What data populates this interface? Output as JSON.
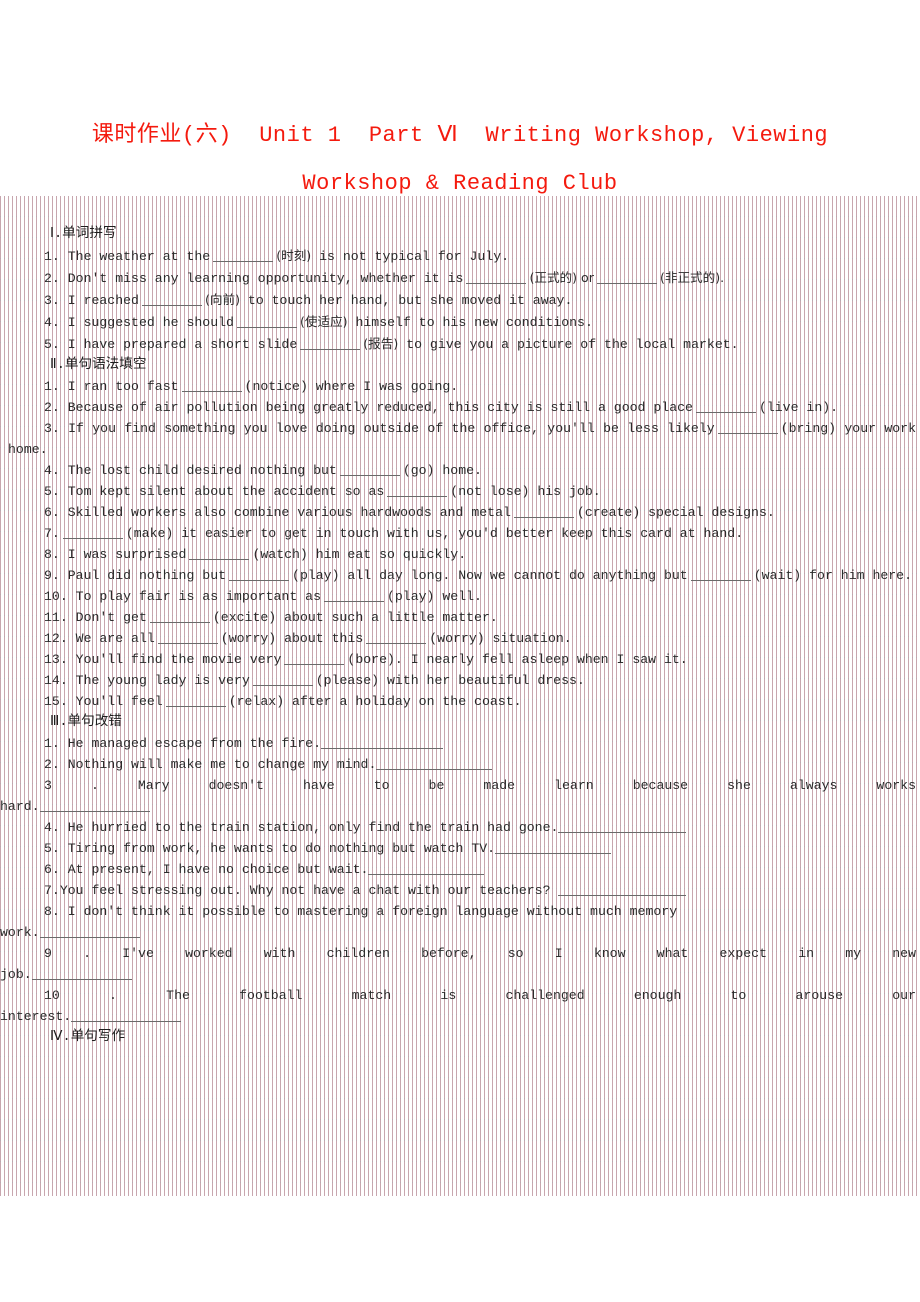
{
  "document": {
    "title_line1": "课时作业(六)  Unit 1  Part Ⅵ  Writing Workshop, Viewing",
    "title_line2": "Workshop & Reading Club",
    "title_color": "#f41a0e"
  },
  "sections": [
    {
      "heading": "Ⅰ.单词拼写",
      "items": [
        "1. The weather at the ______ (时刻) is not typical for July.",
        "2. Don't miss any learning opportunity, whether it is ______ (正式的) or ______ (非正式的).",
        "3. I reached ______ (向前) to touch her hand, but she moved it away.",
        "4. I suggested he should ______ (使适应) himself to his new conditions.",
        "5. I have prepared a short slide ______ (报告) to give you a picture of the local market."
      ]
    },
    {
      "heading": "Ⅱ.单句语法填空",
      "items": [
        "1. I ran too fast ______ (notice) where I was going.",
        "2. Because of air pollution being greatly reduced, this city is still a good place ______ (live in).",
        "3. If you find something you love doing outside of the office, you'll be less likely ______ (bring) your work home.",
        "4. The lost child desired nothing but ______ (go) home.",
        "5. Tom kept silent about the accident so as ______ (not lose) his job.",
        "6. Skilled workers also combine various hardwoods and metal ______ (create) special designs.",
        "7. ______ (make) it easier to get in touch with us, you'd better keep this card at hand.",
        "8. I was surprised ______ (watch) him eat so quickly.",
        "9. Paul did nothing but ______ (play) all day long. Now we cannot do anything but ______ (wait) for him here.",
        "10. To play fair is as important as ______ (play) well.",
        "11. Don't get ______ (excite) about such a little matter.",
        "12. We are all ______ (worry) about this ______ (worry) situation.",
        "13. You'll find the movie very ______ (bore). I nearly fell asleep when I saw it.",
        "14. The young lady is very ______ (please) with her beautiful dress.",
        "15. You'll feel ______ (relax) after a holiday on the coast."
      ]
    },
    {
      "heading": "Ⅲ.单句改错",
      "items": [
        "1. He managed escape from the fire.",
        "2. Nothing will make me to change my mind.",
        "3 . Mary doesn't have to be made learn because she always works hard.",
        "4. He hurried to the train station, only find the train had gone.",
        "5. Tiring from work, he wants to do nothing but watch TV.",
        "6. At present, I have no choice but wait.",
        "7.You feel stressing out. Why not have a chat with our teachers?",
        "8. I don't think it possible to mastering a foreign language without much memory work.",
        "9 . I've worked with children before, so I know what expect in my new job.",
        "10 . The football match is challenged enough to arouse our interest."
      ]
    },
    {
      "heading": "Ⅳ.单句写作",
      "items": []
    }
  ],
  "fragments": {
    "s1_q1_a": "1. The weather at the",
    "s1_q1_cn": "(时刻)",
    "s1_q1_b": "is not typical for July.",
    "s1_q2_a": "2. Don't miss any learning opportunity, whether it is",
    "s1_q2_cn1": "(正式的) or",
    "s1_q2_cn2": "(非正式的).",
    "s1_q3_a": "3. I reached",
    "s1_q3_cn": "(向前)",
    "s1_q3_b": "to touch her hand, but she moved it away.",
    "s1_q4_a": "4. I suggested he should",
    "s1_q4_cn": "(使适应)",
    "s1_q4_b": "himself to his new conditions.",
    "s1_q5_a": "5. I have prepared a short slide",
    "s1_q5_cn": "(报告)",
    "s1_q5_b": "to give you a picture of the local market.",
    "s2_q1_a": "1. I ran too fast",
    "s2_q1_b": "(notice) where I was going.",
    "s2_q2_a": "2. Because of air pollution being greatly reduced, this city is still a good place",
    "s2_q2_b": "(live in).",
    "s2_q3_a": "3. If you find something you love doing outside of the office, you'll be less likely",
    "s2_q3_b": "(bring) your work home.",
    "s2_q4_a": "4. The lost child desired nothing but",
    "s2_q4_b": "(go) home.",
    "s2_q5_a": "5. Tom kept silent about the accident so as",
    "s2_q5_b": "(not lose) his job.",
    "s2_q6_a": "6. Skilled workers also combine various hardwoods and metal",
    "s2_q6_b": "(create) special designs.",
    "s2_q7_a": "7.",
    "s2_q7_b": "(make) it easier to get in touch with us, you'd better keep this card at hand.",
    "s2_q8_a": "8. I was surprised",
    "s2_q8_b": "(watch) him eat so quickly.",
    "s2_q9_a": "9. Paul did nothing but",
    "s2_q9_b": "(play) all day long. Now we cannot do anything but",
    "s2_q9_c": "(wait) for him here.",
    "s2_q10_a": "10. To play fair is as important as",
    "s2_q10_b": "(play) well.",
    "s2_q11_a": "11. Don't get",
    "s2_q11_b": "(excite) about such a little matter.",
    "s2_q12_a": "12. We are all",
    "s2_q12_b": "(worry) about this",
    "s2_q12_c": "(worry) situation.",
    "s2_q13_a": "13. You'll find the movie very",
    "s2_q13_b": "(bore). I nearly fell asleep when I saw it.",
    "s2_q14_a": "14. The young lady is very",
    "s2_q14_b": "(please) with her beautiful dress.",
    "s2_q15_a": "15. You'll feel",
    "s2_q15_b": "(relax) after a holiday on the coast.",
    "s3_q1": "1. He managed escape from the fire.",
    "s3_q2": "2. Nothing will make me to change my mind.",
    "s3_q3": "3 . Mary doesn't have to be made learn because she always works",
    "s3_q3_tail": "hard.",
    "s3_q4": "4. He hurried to the train station, only find the train had gone.",
    "s3_q5": "5. Tiring from work, he wants to do nothing but watch TV.",
    "s3_q6": "6. At present, I have no choice but wait.",
    "s3_q7": "7.You feel stressing out. Why not have a chat with our teachers?",
    "s3_q8": "8. I don't think it possible to mastering a foreign language without much memory",
    "s3_q8_tail": "work.",
    "s3_q9": "9 . I've worked with children before, so I know what expect in my new",
    "s3_q9_tail": "job.",
    "s3_q10": "10 . The football match is challenged enough to arouse our",
    "s3_q10_tail": "interest."
  }
}
